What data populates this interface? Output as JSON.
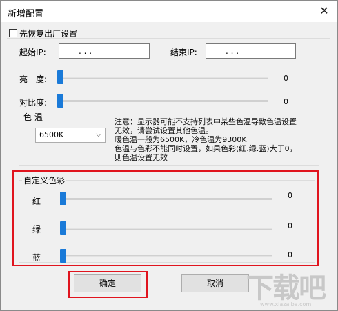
{
  "window": {
    "title": "新增配置",
    "close_glyph": "✕"
  },
  "restore": {
    "label": "先恢复出厂设置",
    "checked": false
  },
  "ip": {
    "start_label": "起始IP:",
    "end_label": "结束IP:",
    "start_value": ".  .  .",
    "end_value": ".  .  ."
  },
  "brightness": {
    "label": "亮　度:",
    "value": "0",
    "level": 0
  },
  "contrast": {
    "label": "对比度:",
    "value": "0",
    "level": 0
  },
  "color_temp": {
    "group_label": "色 温",
    "selected": "6500K",
    "note_lines": [
      "注意：显示器可能不支持列表中某些色温导致色温设置",
      "无效，请尝试设置其他色温。",
      "暖色温一般为6500K，冷色温为9300K",
      "色温与色彩不能同时设置，如果色彩(红.绿.蓝)大于0，",
      "则色温设置无效"
    ]
  },
  "custom_color": {
    "group_label": "自定义色彩",
    "red": {
      "label": "红",
      "value": "0",
      "level": 0
    },
    "green": {
      "label": "绿",
      "value": "0",
      "level": 0
    },
    "blue": {
      "label": "蓝",
      "value": "0",
      "level": 0
    }
  },
  "buttons": {
    "ok": "确定",
    "cancel": "取消"
  },
  "colors": {
    "accent": "#1a7ad8",
    "highlight": "#e0141e"
  },
  "watermark": {
    "text": "下载吧",
    "sub": "www.xiazaiba.com"
  }
}
